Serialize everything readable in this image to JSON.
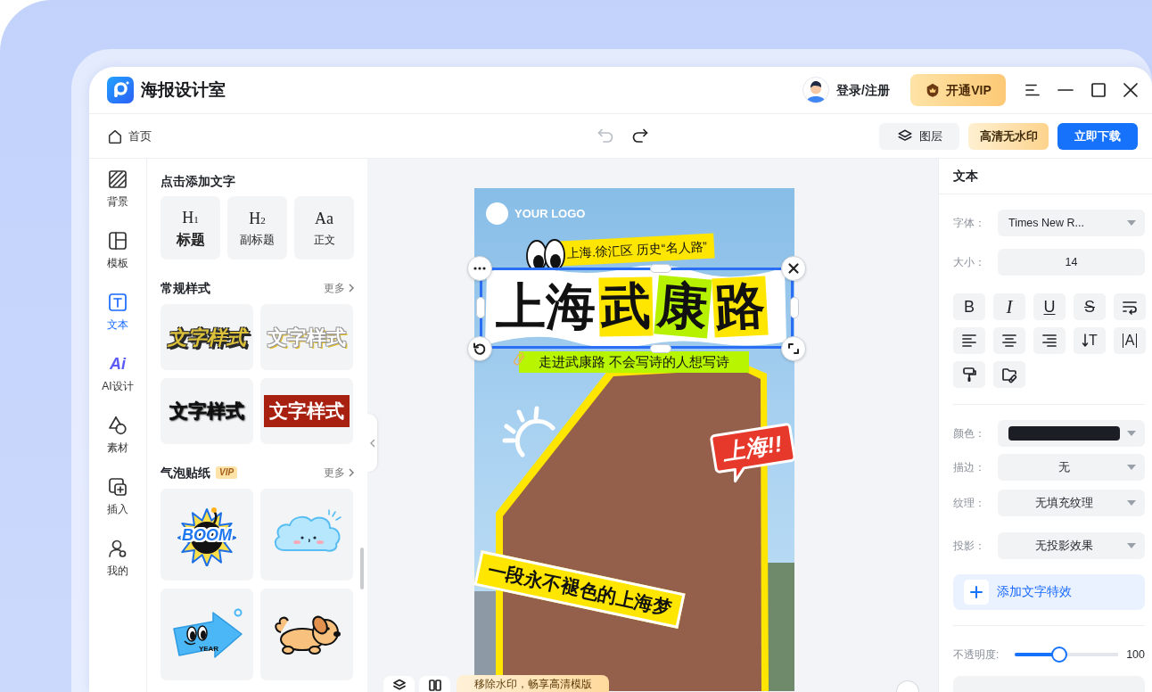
{
  "app": {
    "title": "海报设计室",
    "login": "登录/注册",
    "vip_button": "开通VIP"
  },
  "toolbar": {
    "home": "首页",
    "undo": {
      "disabled": true
    },
    "redo": {
      "disabled": false
    },
    "layers_button": "图层",
    "hd_button": "高清无水印",
    "download_button": "立即下载"
  },
  "sidebar": {
    "items": [
      {
        "label": "背景",
        "selected": false
      },
      {
        "label": "模板",
        "selected": false
      },
      {
        "label": "文本",
        "selected": true
      },
      {
        "label": "AI设计",
        "selected": false,
        "icon_text": "Ai"
      },
      {
        "label": "素材",
        "selected": false
      },
      {
        "label": "插入",
        "selected": false
      },
      {
        "label": "我的",
        "selected": false
      }
    ]
  },
  "panel": {
    "add_text": {
      "title": "点击添加文字",
      "presets": [
        {
          "kind": "title",
          "preview": "H$_{1}$",
          "label": "标题"
        },
        {
          "kind": "subtitle",
          "preview": "H$_{2}$",
          "label": "副标题"
        },
        {
          "kind": "body",
          "preview": "Aa",
          "label": "正文"
        }
      ]
    },
    "text_styles": {
      "title": "常规样式",
      "more": "更多",
      "items": [
        {
          "kind": "outline",
          "text": "文字样式"
        },
        {
          "kind": "glow",
          "text": "文字样式"
        },
        {
          "kind": "heavy",
          "text": "文字样式"
        },
        {
          "kind": "boxed",
          "text": "文字样式"
        }
      ]
    },
    "stickers": {
      "title": "气泡贴纸",
      "badge": "VIP",
      "more": "更多",
      "items": [
        {
          "kind": "bomb",
          "text": "BOOM"
        },
        {
          "kind": "cloud"
        },
        {
          "kind": "arrow",
          "text": "YEAR"
        },
        {
          "kind": "dog"
        }
      ]
    }
  },
  "canvas": {
    "poster": {
      "logo_text": "YOUR LOGO",
      "tag": "上海.徐汇区 历史“名人路”",
      "title_parts": [
        {
          "text": "上海"
        },
        {
          "text": "武",
          "color": "#ffe600"
        },
        {
          "text": "康",
          "color": "#b6f200"
        },
        {
          "text": "路",
          "color": "#ffe600"
        }
      ],
      "title_selected": true,
      "subtitle": "走进武康路 不会写诗的人想写诗",
      "bubble": "上海!!",
      "banner": "一段永不褪色的上海梦"
    },
    "notice": "移除水印，畅享高清模版"
  },
  "properties": {
    "title": "文本",
    "fields": [
      {
        "kind": "font",
        "label": "字体：",
        "value": "Times New R..."
      },
      {
        "kind": "input",
        "label": "大小：",
        "value": "14"
      }
    ],
    "format_buttons": [
      {
        "kind": "bold",
        "text": "B"
      },
      {
        "kind": "italic",
        "text": "I"
      },
      {
        "kind": "underline",
        "text": "U"
      },
      {
        "kind": "strike",
        "text": "S"
      },
      {
        "kind": "wrap"
      },
      {
        "kind": "align-left"
      },
      {
        "kind": "align-center"
      },
      {
        "kind": "align-right"
      },
      {
        "kind": "line-height",
        "text": "T"
      },
      {
        "kind": "spacing",
        "text": "A"
      },
      {
        "kind": "painter"
      },
      {
        "kind": "folder-link"
      }
    ],
    "style_fields": [
      {
        "kind": "color",
        "label": "颜色：",
        "color": "#1c1e25"
      },
      {
        "kind": "select",
        "label": "描边：",
        "value": "无"
      },
      {
        "kind": "select",
        "label": "纹理：",
        "value": "无填充纹理"
      },
      {
        "kind": "select",
        "label": "投影：",
        "value": "无投影效果"
      }
    ],
    "effect_button": "添加文字特效",
    "opacity": {
      "label": "不透明度:",
      "level": 0.43,
      "reading": "100"
    }
  }
}
